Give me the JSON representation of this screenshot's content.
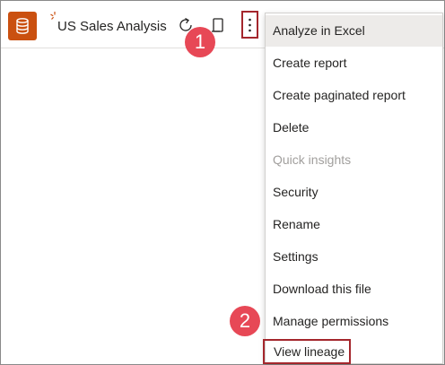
{
  "header": {
    "title": "US Sales Analysis",
    "dataset_icon": "database-icon",
    "sparkle_icon": "new-sparkle-icon",
    "refresh_icon": "refresh-icon",
    "device_icon": "device-icon",
    "more_icon": "more-options-vertical-icon"
  },
  "callouts": [
    "1",
    "2"
  ],
  "menu": {
    "items": [
      {
        "label": "Analyze in Excel",
        "state": "hover"
      },
      {
        "label": "Create report",
        "state": "normal"
      },
      {
        "label": "Create paginated report",
        "state": "normal"
      },
      {
        "label": "Delete",
        "state": "normal"
      },
      {
        "label": "Quick insights",
        "state": "disabled"
      },
      {
        "label": "Security",
        "state": "normal"
      },
      {
        "label": "Rename",
        "state": "normal"
      },
      {
        "label": "Settings",
        "state": "normal"
      },
      {
        "label": "Download this file",
        "state": "normal"
      },
      {
        "label": "Manage permissions",
        "state": "normal"
      },
      {
        "label": "View lineage",
        "state": "highlighted-box"
      }
    ]
  },
  "colors": {
    "brand": "#ca5010",
    "highlight_border": "#a4262c",
    "callout": "#e74856",
    "hover_bg": "#edebe9",
    "disabled_text": "#a19f9d"
  }
}
